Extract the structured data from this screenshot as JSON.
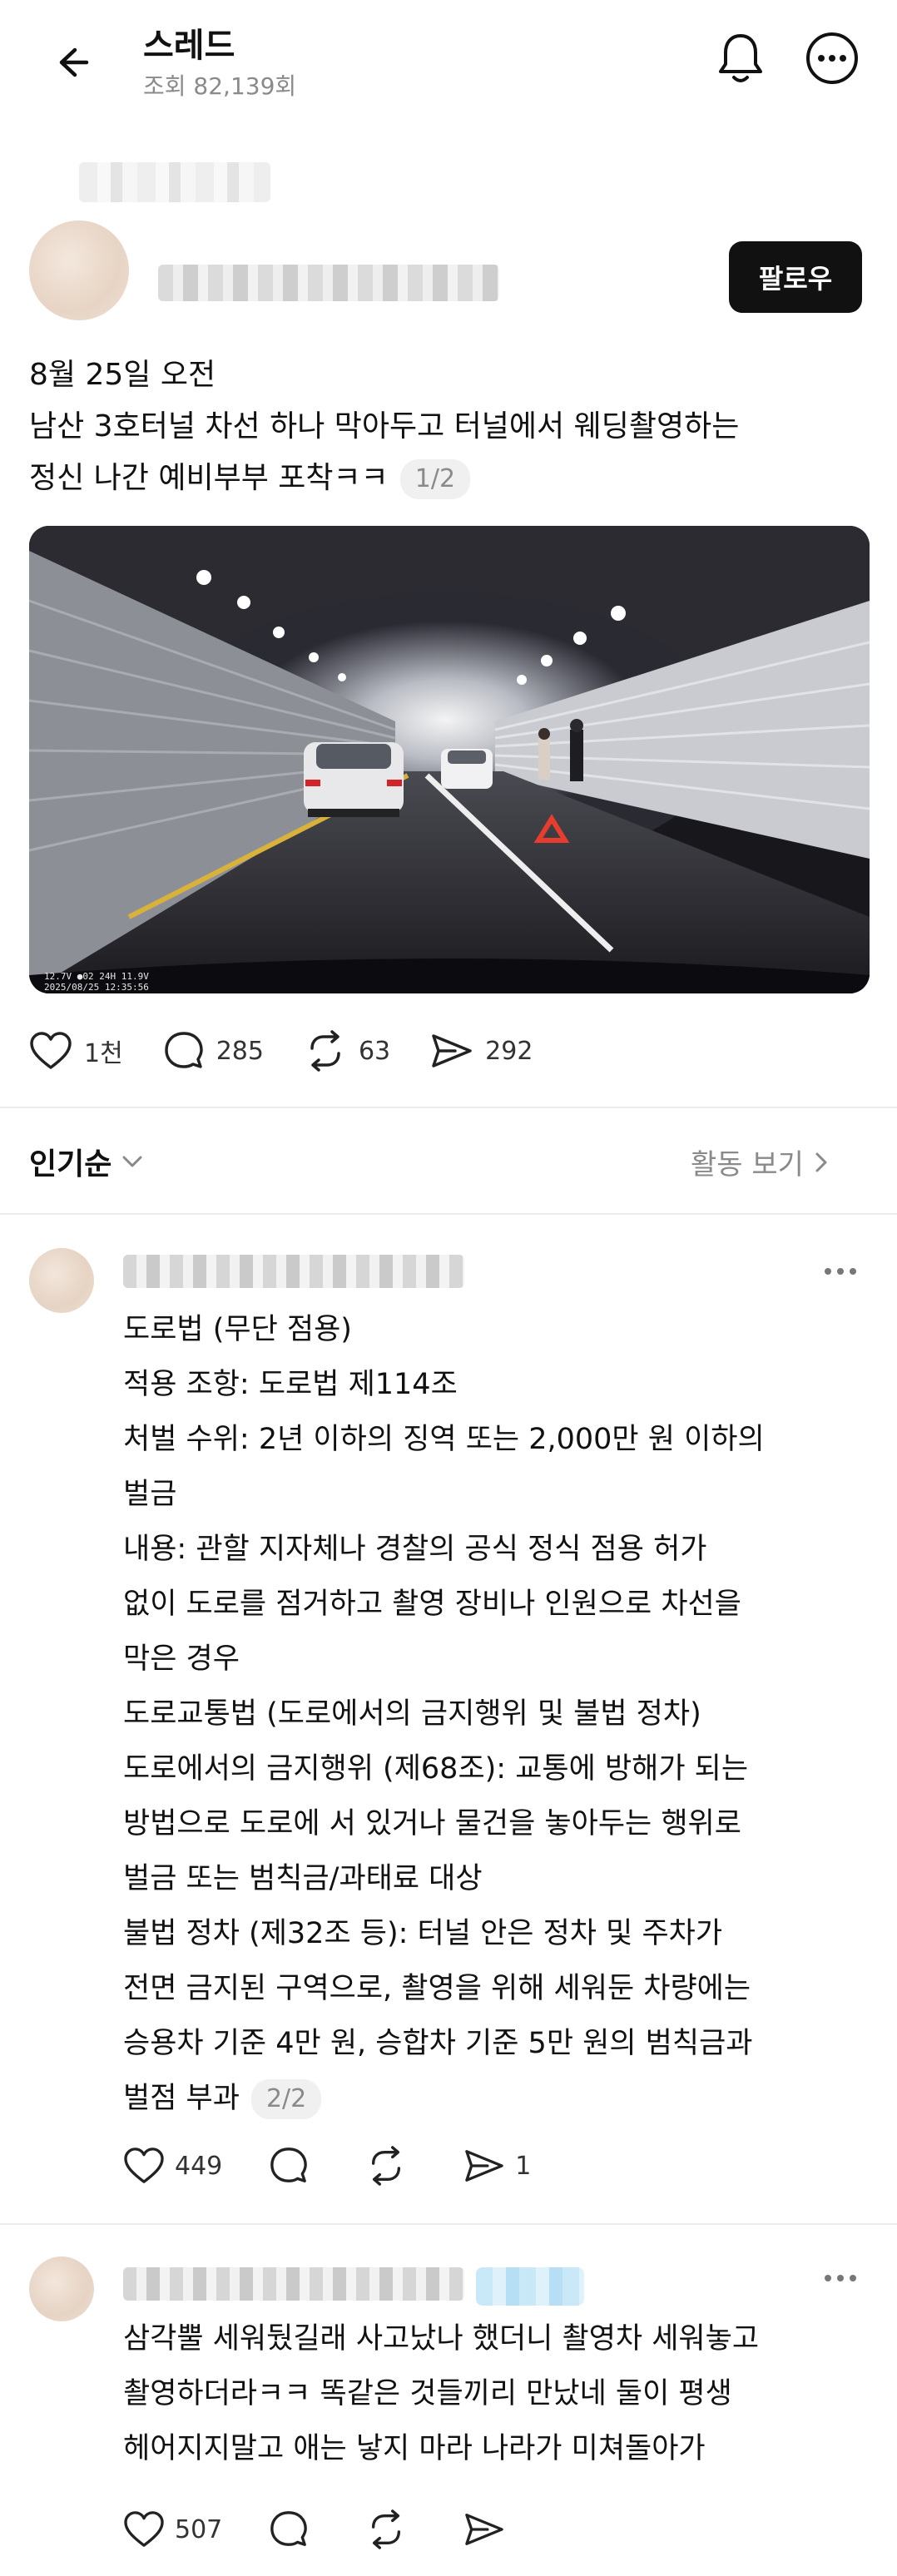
{
  "header": {
    "title": "스레드",
    "views": "조회 82,139회"
  },
  "post": {
    "follow_label": "팔로우",
    "lines": [
      "8월 25일 오전",
      "남산 3호터널 차선 하나 막아두고 터널에서 웨딩촬영하는",
      "정신 나간 예비부부 포착ㅋㅋ"
    ],
    "page_indicator": "1/2",
    "image_icon": "dashcam-tunnel-image",
    "stats": {
      "likes": "1천",
      "comments": "285",
      "reposts": "63",
      "shares": "292"
    }
  },
  "sort": {
    "label": "인기순",
    "activity_label": "활동 보기"
  },
  "comments": [
    {
      "lines": [
        "도로법 (무단 점용)",
        " 적용 조항: 도로법 제114조",
        " 처벌 수위: 2년 이하의 징역 또는 2,000만 원 이하의",
        "벌금",
        " 내용: 관할 지자체나 경찰의 공식 정식 점용 허가",
        "없이 도로를 점거하고 촬영 장비나 인원으로 차선을",
        "막은 경우",
        "도로교통법 (도로에서의 금지행위 및 불법 정차)",
        " 도로에서의 금지행위 (제68조): 교통에 방해가 되는",
        "방법으로 도로에 서 있거나 물건을 놓아두는 행위로",
        "벌금 또는 범칙금/과태료 대상",
        " 불법 정차 (제32조 등): 터널 안은 정차 및 주차가",
        "전면 금지된 구역으로, 촬영을 위해 세워둔 차량에는",
        "승용차 기준 4만 원, 승합차 기준 5만 원의 범칙금과",
        "벌점 부과"
      ],
      "page_indicator": "2/2",
      "likes": "449",
      "shares": "1"
    },
    {
      "lines": [
        "삼각뿔 세워뒀길래 사고났나 했더니 촬영차 세워놓고",
        "촬영하더라ㅋㅋ 똑같은 것들끼리 만났네 둘이 평생",
        "헤어지지말고 애는 낳지 마라 나라가 미쳐돌아가"
      ],
      "likes": "507"
    }
  ],
  "colors": {
    "text": "#111111",
    "muted": "#8a8a8a",
    "follow_bg": "#111111",
    "badge_bg": "#f0f0f0"
  }
}
